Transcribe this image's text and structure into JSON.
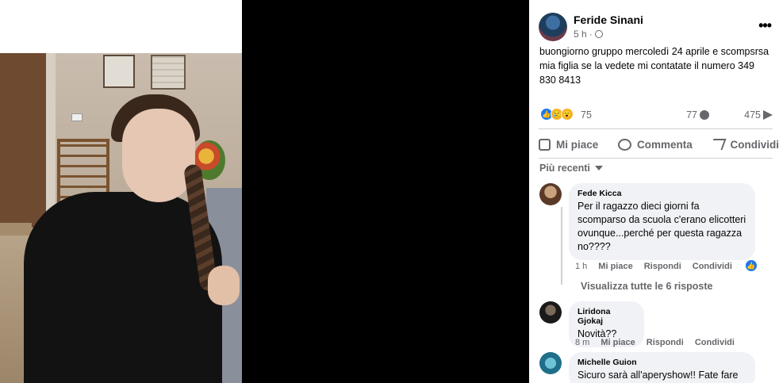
{
  "post": {
    "author": "Feride Sinani",
    "time": "5 h",
    "dot": "·",
    "text": "buongiorno gruppo mercoledì 24 aprile e scompsrsa mia figlia se la vedete mi contatate il numero 349 830 8413",
    "reaction_count": "75",
    "comment_count": "77",
    "share_count": "475",
    "more_icon": "more-horizontal-icon"
  },
  "actions": {
    "like": "Mi piace",
    "comment": "Commenta",
    "share": "Condividi"
  },
  "sort": {
    "label": "Più recenti"
  },
  "comments": [
    {
      "name": "Fede Kicca",
      "text": "Per il ragazzo dieci giorni fa scomparso da scuola c'erano elicotteri ovunque...perché per questa ragazza no????",
      "time": "1 h",
      "like": "Mi piace",
      "reply": "Rispondi",
      "share": "Condividi",
      "replies_link": "Visualizza tutte le 6 risposte"
    },
    {
      "name": "Liridona Gjokaj",
      "text": "Novità??",
      "time": "8 m",
      "like": "Mi piace",
      "reply": "Rispondi",
      "share": "Condividi"
    },
    {
      "name": "Michelle Guion",
      "text": "Sicuro sarà all'aperyshow!! Fate fare"
    }
  ],
  "colors": {
    "accent": "#1877f2",
    "secondary_text": "#65676b",
    "bubble": "#f0f2f5"
  }
}
